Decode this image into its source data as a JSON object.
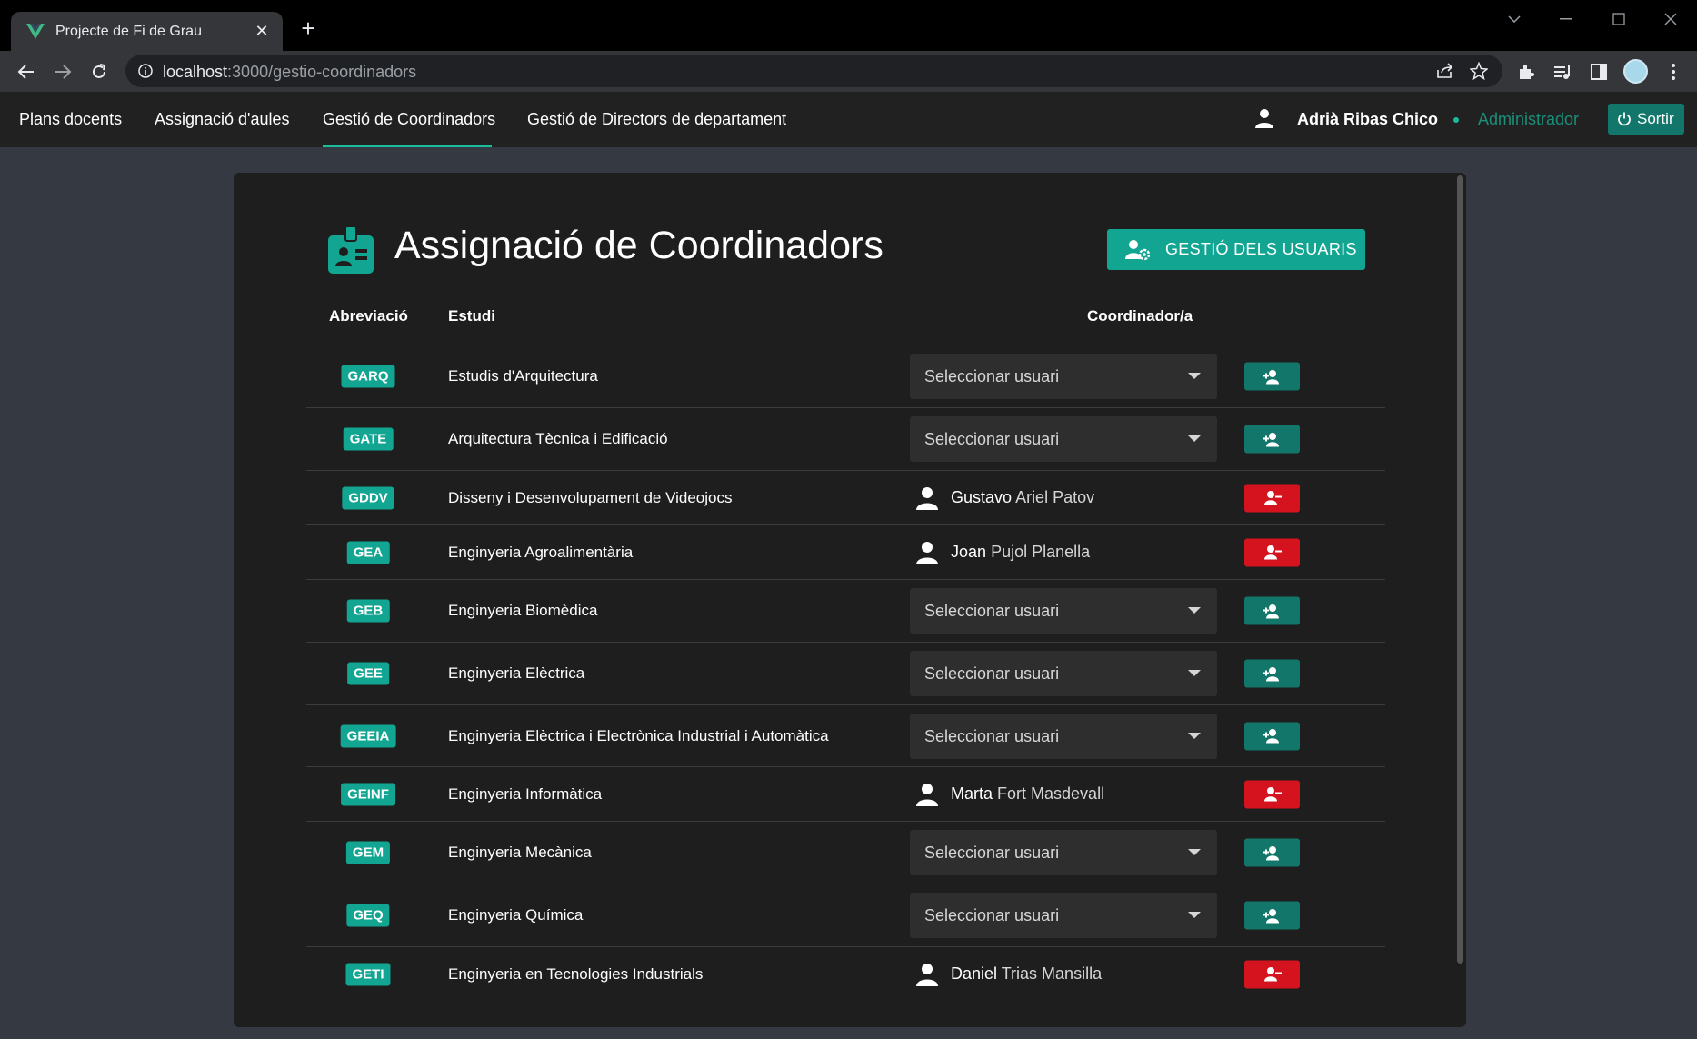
{
  "browser": {
    "tab_title": "Projecte de Fi de Grau",
    "url_host": "localhost",
    "url_path": ":3000/gestio-coordinadors"
  },
  "nav": {
    "links": [
      "Plans docents",
      "Assignació d'aules",
      "Gestió de Coordinadors",
      "Gestió de Directors de departament"
    ],
    "active_index": 2,
    "user_name": "Adrià Ribas Chico",
    "role": "Administrador",
    "logout_label": "Sortir"
  },
  "page": {
    "title": "Assignació de Coordinadors",
    "users_button": "GESTIÓ DELS USUARIS",
    "col_abbr": "Abreviació",
    "col_study": "Estudi",
    "col_coord": "Coordinador/a",
    "select_placeholder": "Seleccionar usuari"
  },
  "rows": [
    {
      "abbr": "GARQ",
      "study": "Estudis d'Arquitectura",
      "coord_first": "",
      "coord_last": ""
    },
    {
      "abbr": "GATE",
      "study": "Arquitectura Tècnica i Edificació",
      "coord_first": "",
      "coord_last": ""
    },
    {
      "abbr": "GDDV",
      "study": "Disseny i Desenvolupament de Videojocs",
      "coord_first": "Gustavo",
      "coord_last": "Ariel Patov"
    },
    {
      "abbr": "GEA",
      "study": "Enginyeria Agroalimentària",
      "coord_first": "Joan",
      "coord_last": "Pujol Planella"
    },
    {
      "abbr": "GEB",
      "study": "Enginyeria Biomèdica",
      "coord_first": "",
      "coord_last": ""
    },
    {
      "abbr": "GEE",
      "study": "Enginyeria Elèctrica",
      "coord_first": "",
      "coord_last": ""
    },
    {
      "abbr": "GEEIA",
      "study": "Enginyeria Elèctrica i Electrònica Industrial i Automàtica",
      "coord_first": "",
      "coord_last": ""
    },
    {
      "abbr": "GEINF",
      "study": "Enginyeria Informàtica",
      "coord_first": "Marta",
      "coord_last": "Fort Masdevall"
    },
    {
      "abbr": "GEM",
      "study": "Enginyeria Mecànica",
      "coord_first": "",
      "coord_last": ""
    },
    {
      "abbr": "GEQ",
      "study": "Enginyeria Química",
      "coord_first": "",
      "coord_last": ""
    },
    {
      "abbr": "GETI",
      "study": "Enginyeria en Tecnologies Industrials",
      "coord_first": "Daniel",
      "coord_last": "Trias Mansilla"
    }
  ],
  "colors": {
    "accent": "#12a592",
    "add_button": "#12776a",
    "remove_button": "#d5131f",
    "card_bg": "#1e1e1e"
  }
}
